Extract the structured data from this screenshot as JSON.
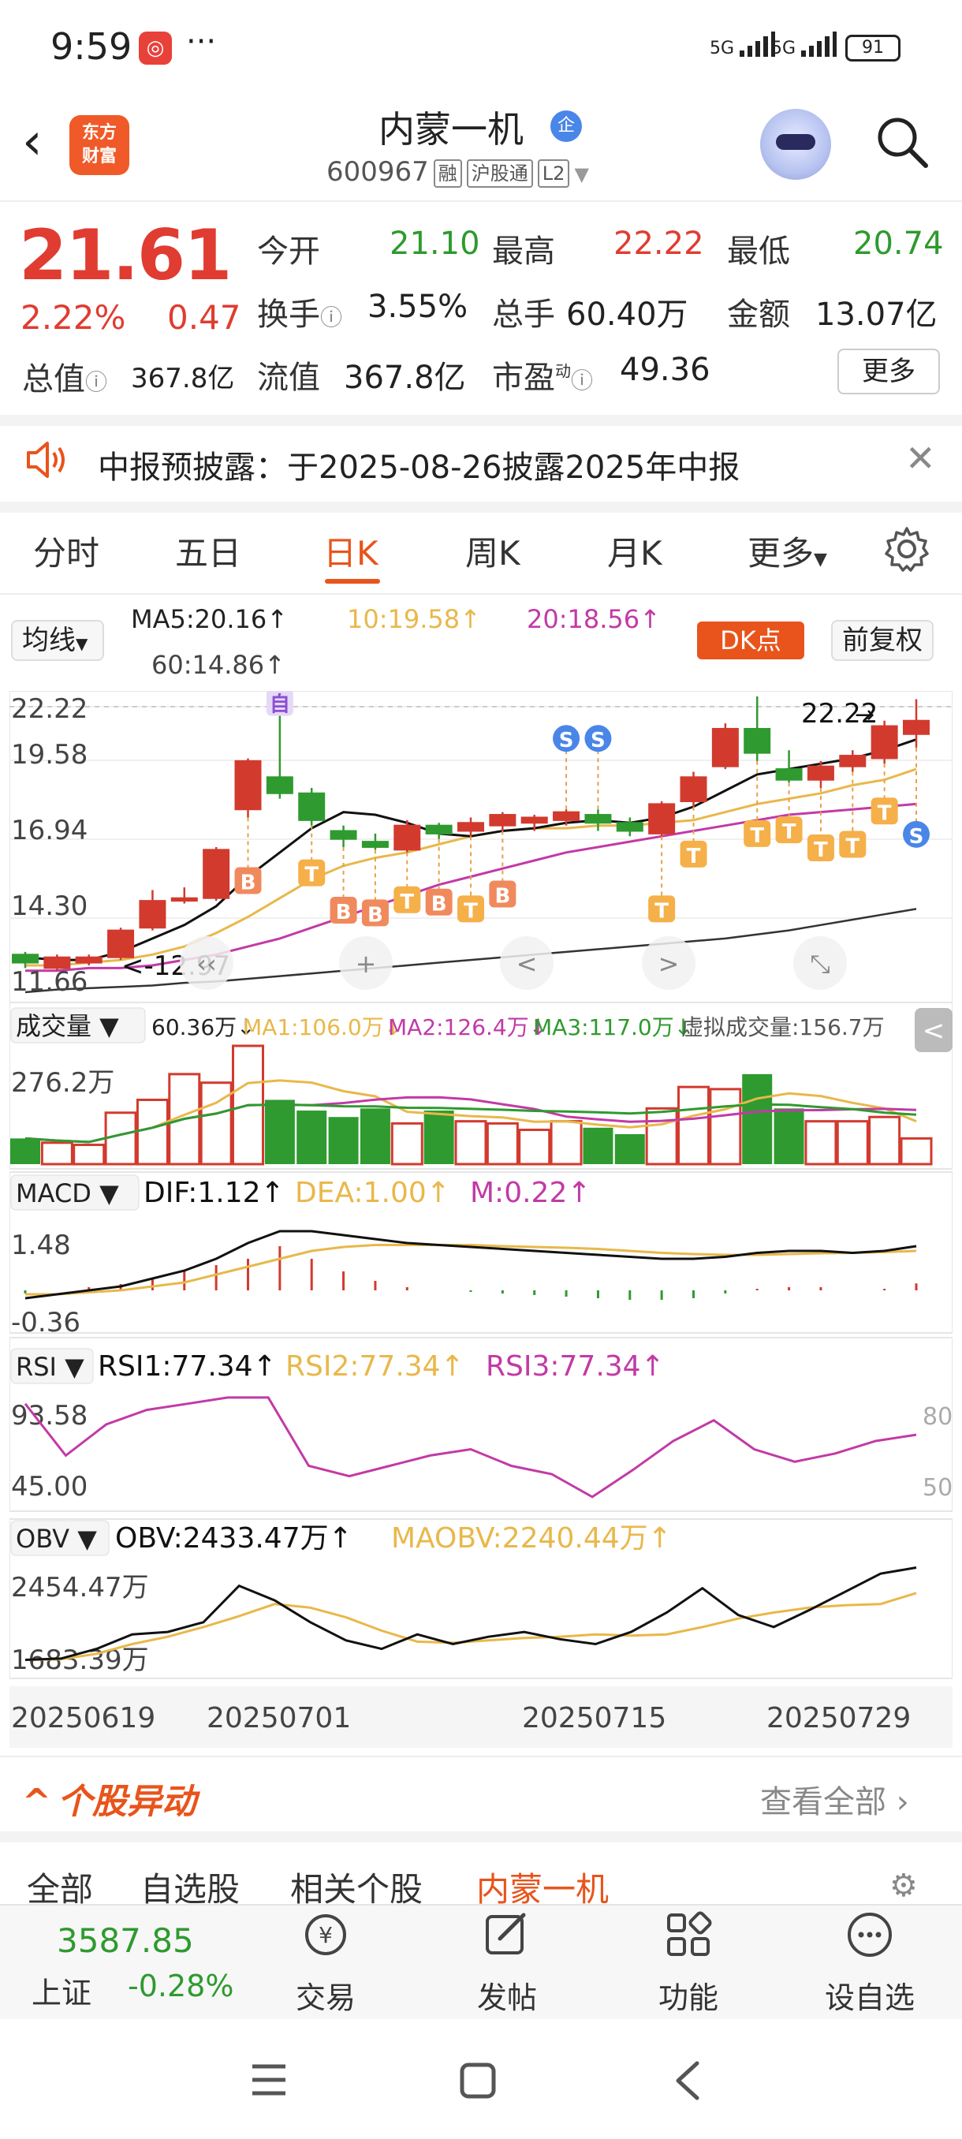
{
  "status_bar": {
    "time": "9:59",
    "dots": "···",
    "sim1": "5G",
    "sim2": "5G",
    "battery": "91"
  },
  "header": {
    "back": "‹",
    "brand_line1": "东方",
    "brand_line2": "财富",
    "stock_name": "内蒙一机",
    "enterprise_badge": "企",
    "stock_code": "600967",
    "tags": [
      "融",
      "沪股通",
      "L2"
    ]
  },
  "quote": {
    "last_price": "21.61",
    "change_pct": "2.22%",
    "change_amt": "0.47",
    "open_label": "今开",
    "open": "21.10",
    "high_label": "最高",
    "high": "22.22",
    "low_label": "最低",
    "low": "20.74",
    "turnover_label": "换手",
    "turnover": "3.55%",
    "volume_label": "总手",
    "volume": "60.40万",
    "amount_label": "金额",
    "amount": "13.07亿",
    "total_mv_label": "总值",
    "total_mv": "367.8亿",
    "float_mv_label": "流值",
    "float_mv": "367.8亿",
    "pe_label": "市盈",
    "pe_sup": "动",
    "pe": "49.36",
    "more_button": "更多"
  },
  "notice": {
    "text": "中报预披露：于2025-08-26披露2025年中报"
  },
  "period_tabs": [
    "分时",
    "五日",
    "日K",
    "周K",
    "月K",
    "更多"
  ],
  "active_period": "日K",
  "ma_bar": {
    "select": "均线",
    "ma5": "MA5:20.16↑",
    "ma10": "10:19.58↑",
    "ma20": "20:18.56↑",
    "ma60": "60:14.86↑",
    "dk_button": "DK点",
    "adj_button": "前复权"
  },
  "chart_data": {
    "type": "candlestick",
    "x_labels": [
      "20250619",
      "20250701",
      "20250715",
      "20250729"
    ],
    "y_ticks": [
      "22.22",
      "19.58",
      "16.94",
      "14.30",
      "11.66"
    ],
    "ylim": [
      11.66,
      22.22
    ],
    "last_price_label": "22.22",
    "low_label": "12.97",
    "candles": [
      {
        "o": 13.0,
        "c": 12.7,
        "h": 13.1,
        "l": 12.5
      },
      {
        "o": 12.5,
        "c": 12.9,
        "h": 13.0,
        "l": 12.4
      },
      {
        "o": 12.7,
        "c": 12.9,
        "h": 13.0,
        "l": 12.6
      },
      {
        "o": 12.9,
        "c": 13.9,
        "h": 14.0,
        "l": 12.8
      },
      {
        "o": 14.0,
        "c": 15.0,
        "h": 15.4,
        "l": 13.9
      },
      {
        "o": 15.0,
        "c": 15.1,
        "h": 15.5,
        "l": 14.9
      },
      {
        "o": 15.1,
        "c": 16.9,
        "h": 17.0,
        "l": 15.0
      },
      {
        "o": 18.4,
        "c": 20.2,
        "h": 20.3,
        "l": 18.1
      },
      {
        "o": 19.6,
        "c": 19.0,
        "h": 22.2,
        "l": 18.8
      },
      {
        "o": 19.0,
        "c": 18.0,
        "h": 19.2,
        "l": 17.8
      },
      {
        "o": 17.6,
        "c": 17.3,
        "h": 17.8,
        "l": 17.0
      },
      {
        "o": 17.2,
        "c": 17.0,
        "h": 17.5,
        "l": 16.9
      },
      {
        "o": 16.9,
        "c": 17.8,
        "h": 18.0,
        "l": 16.8
      },
      {
        "o": 17.8,
        "c": 17.5,
        "h": 17.9,
        "l": 17.3
      },
      {
        "o": 17.6,
        "c": 17.9,
        "h": 18.1,
        "l": 17.4
      },
      {
        "o": 17.8,
        "c": 18.2,
        "h": 18.3,
        "l": 17.6
      },
      {
        "o": 17.9,
        "c": 18.1,
        "h": 18.2,
        "l": 17.6
      },
      {
        "o": 18.0,
        "c": 18.3,
        "h": 18.4,
        "l": 17.8
      },
      {
        "o": 18.2,
        "c": 17.9,
        "h": 18.4,
        "l": 17.6
      },
      {
        "o": 17.9,
        "c": 17.6,
        "h": 18.1,
        "l": 17.4
      },
      {
        "o": 17.5,
        "c": 18.6,
        "h": 18.7,
        "l": 17.4
      },
      {
        "o": 18.7,
        "c": 19.6,
        "h": 19.8,
        "l": 18.5
      },
      {
        "o": 20.0,
        "c": 21.4,
        "h": 21.6,
        "l": 19.9
      },
      {
        "o": 21.4,
        "c": 20.5,
        "h": 22.6,
        "l": 20.2
      },
      {
        "o": 19.9,
        "c": 19.5,
        "h": 20.6,
        "l": 19.4
      },
      {
        "o": 19.5,
        "c": 20.0,
        "h": 20.2,
        "l": 19.2
      },
      {
        "o": 20.0,
        "c": 20.4,
        "h": 20.6,
        "l": 19.8
      },
      {
        "o": 20.3,
        "c": 21.5,
        "h": 21.7,
        "l": 20.1
      },
      {
        "o": 21.2,
        "c": 21.7,
        "h": 22.5,
        "l": 20.7
      }
    ],
    "ma5": [
      12.9,
      12.8,
      12.8,
      13.1,
      13.6,
      14.1,
      14.8,
      15.9,
      16.8,
      17.7,
      18.3,
      18.2,
      17.9,
      17.5,
      17.4,
      17.6,
      17.7,
      17.9,
      18.0,
      17.9,
      18.1,
      18.5,
      19.1,
      19.7,
      19.9,
      20.1,
      20.3,
      20.6,
      21.0
    ],
    "ma10": [
      12.6,
      12.6,
      12.7,
      12.8,
      13.0,
      13.3,
      13.8,
      14.4,
      15.1,
      15.8,
      16.3,
      16.6,
      16.8,
      17.1,
      17.4,
      17.6,
      17.7,
      17.7,
      17.8,
      17.8,
      17.9,
      18.0,
      18.3,
      18.6,
      18.8,
      19.0,
      19.3,
      19.5,
      19.9
    ],
    "ma20": [
      12.4,
      12.4,
      12.5,
      12.5,
      12.6,
      12.8,
      13.0,
      13.3,
      13.6,
      14.0,
      14.4,
      14.8,
      15.2,
      15.6,
      15.9,
      16.2,
      16.5,
      16.8,
      17.0,
      17.2,
      17.4,
      17.6,
      17.8,
      18.0,
      18.2,
      18.3,
      18.4,
      18.5,
      18.6
    ],
    "ma60": [
      11.6,
      11.7,
      11.75,
      11.8,
      11.85,
      11.95,
      12.0,
      12.1,
      12.2,
      12.3,
      12.4,
      12.5,
      12.6,
      12.7,
      12.8,
      12.9,
      13.0,
      13.1,
      13.2,
      13.3,
      13.4,
      13.5,
      13.6,
      13.75,
      13.9,
      14.1,
      14.3,
      14.5,
      14.7
    ],
    "signals": [
      {
        "i": 8,
        "text": "自"
      },
      {
        "i": 7,
        "text": "B"
      },
      {
        "i": 9,
        "text": "T"
      },
      {
        "i": 10,
        "text": "B"
      },
      {
        "i": 11,
        "text": "B"
      },
      {
        "i": 12,
        "text": "T"
      },
      {
        "i": 13,
        "text": "B"
      },
      {
        "i": 14,
        "text": "T"
      },
      {
        "i": 15,
        "text": "B"
      },
      {
        "i": 17,
        "text": "S"
      },
      {
        "i": 18,
        "text": "S"
      },
      {
        "i": 20,
        "text": "T"
      },
      {
        "i": 21,
        "text": "T"
      },
      {
        "i": 23,
        "text": "T"
      },
      {
        "i": 24,
        "text": "T"
      },
      {
        "i": 25,
        "text": "T"
      },
      {
        "i": 26,
        "text": "T"
      },
      {
        "i": 27,
        "text": "T"
      },
      {
        "i": 28,
        "text": "S"
      }
    ],
    "volume": {
      "select": "成交量",
      "current": "60.36万↓",
      "ma1": "MA1:106.0万↓",
      "ma2": "MA2:126.4万↓",
      "ma3": "MA3:117.0万↓",
      "virtual": "虚拟成交量:156.7万",
      "y_tick": "276.2万",
      "values": [
        60,
        50,
        45,
        120,
        150,
        210,
        190,
        276,
        150,
        125,
        110,
        130,
        95,
        125,
        100,
        95,
        80,
        100,
        85,
        70,
        130,
        180,
        175,
        210,
        130,
        100,
        100,
        110,
        60
      ]
    },
    "macd": {
      "select": "MACD",
      "dif": "DIF:1.12↑",
      "dea": "DEA:1.00↑",
      "m": "M:0.22↑",
      "ticks": [
        "1.48",
        "-0.36"
      ],
      "dif_series": [
        -0.2,
        -0.1,
        0.0,
        0.1,
        0.3,
        0.5,
        0.8,
        1.2,
        1.5,
        1.5,
        1.4,
        1.3,
        1.2,
        1.15,
        1.1,
        1.05,
        1.0,
        0.95,
        0.9,
        0.85,
        0.8,
        0.8,
        0.85,
        0.95,
        1.0,
        1.0,
        0.95,
        1.0,
        1.12
      ],
      "dea_series": [
        -0.1,
        -0.1,
        -0.05,
        0.0,
        0.1,
        0.2,
        0.4,
        0.6,
        0.8,
        1.0,
        1.1,
        1.15,
        1.15,
        1.15,
        1.15,
        1.12,
        1.1,
        1.08,
        1.05,
        1.0,
        0.95,
        0.92,
        0.9,
        0.9,
        0.92,
        0.94,
        0.95,
        0.97,
        1.0
      ],
      "hist": [
        -0.1,
        0.0,
        0.1,
        0.2,
        0.4,
        0.6,
        0.8,
        1.0,
        1.4,
        1.0,
        0.6,
        0.3,
        0.1,
        0.0,
        -0.05,
        -0.1,
        -0.15,
        -0.2,
        -0.25,
        -0.3,
        -0.3,
        -0.25,
        -0.1,
        0.05,
        0.1,
        0.1,
        0.0,
        0.05,
        0.22
      ]
    },
    "rsi": {
      "select": "RSI",
      "rsi1": "RSI1:77.34↑",
      "rsi2": "RSI2:77.34↑",
      "rsi3": "RSI3:77.34↑",
      "ticks": [
        "93.58",
        "45.00"
      ],
      "right_ticks": [
        "80",
        "50"
      ],
      "values": [
        90,
        65,
        80,
        87,
        90,
        93,
        93,
        60,
        55,
        60,
        65,
        68,
        60,
        56,
        45,
        58,
        72,
        82,
        68,
        62,
        66,
        72,
        75
      ]
    },
    "obv": {
      "select": "OBV",
      "obv": "OBV:2433.47万↑",
      "maobv": "MAOBV:2240.44万↑",
      "ticks": [
        "2454.47万",
        "1683.39万"
      ],
      "obv_series": [
        1690,
        1700,
        1780,
        1900,
        1920,
        2000,
        2300,
        2180,
        2000,
        1850,
        1780,
        1900,
        1820,
        1880,
        1920,
        1860,
        1820,
        1920,
        2080,
        2280,
        2060,
        1960,
        2100,
        2250,
        2400,
        2450
      ],
      "ma_series": [
        1690,
        1695,
        1740,
        1820,
        1880,
        1960,
        2050,
        2150,
        2120,
        2040,
        1930,
        1840,
        1830,
        1850,
        1870,
        1880,
        1900,
        1890,
        1900,
        1960,
        2030,
        2080,
        2120,
        2140,
        2150,
        2240
      ]
    }
  },
  "movement": {
    "title": "个股异动",
    "view_all": "查看全部",
    "filters": [
      "全部",
      "自选股",
      "相关个股",
      "内蒙一机"
    ]
  },
  "bottom_bar": {
    "index_value": "3587.85",
    "index_name": "上证",
    "index_change": "-0.28%",
    "nav": [
      "交易",
      "发帖",
      "功能",
      "设自选"
    ]
  }
}
